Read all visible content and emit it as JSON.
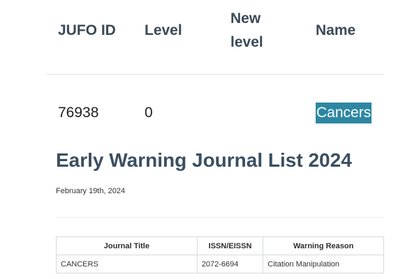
{
  "jufo_table": {
    "headers": {
      "id": "JUFO ID",
      "level": "Level",
      "new_level_line1": "New",
      "new_level_line2": "level",
      "name": "Name"
    },
    "row": {
      "id": "76938",
      "level": "0",
      "name": "Cancers"
    },
    "highlight_color": "#2d87a2"
  },
  "article": {
    "title": "Early Warning Journal List 2024",
    "date": "February 19th, 2024"
  },
  "warning_table": {
    "headers": {
      "title": "Journal Title",
      "issn": "ISSN/EISSN",
      "reason": "Warning Reason"
    },
    "rows": [
      {
        "title": "CANCERS",
        "issn": "2072-6694",
        "reason": "Citation Manipulation"
      }
    ]
  }
}
